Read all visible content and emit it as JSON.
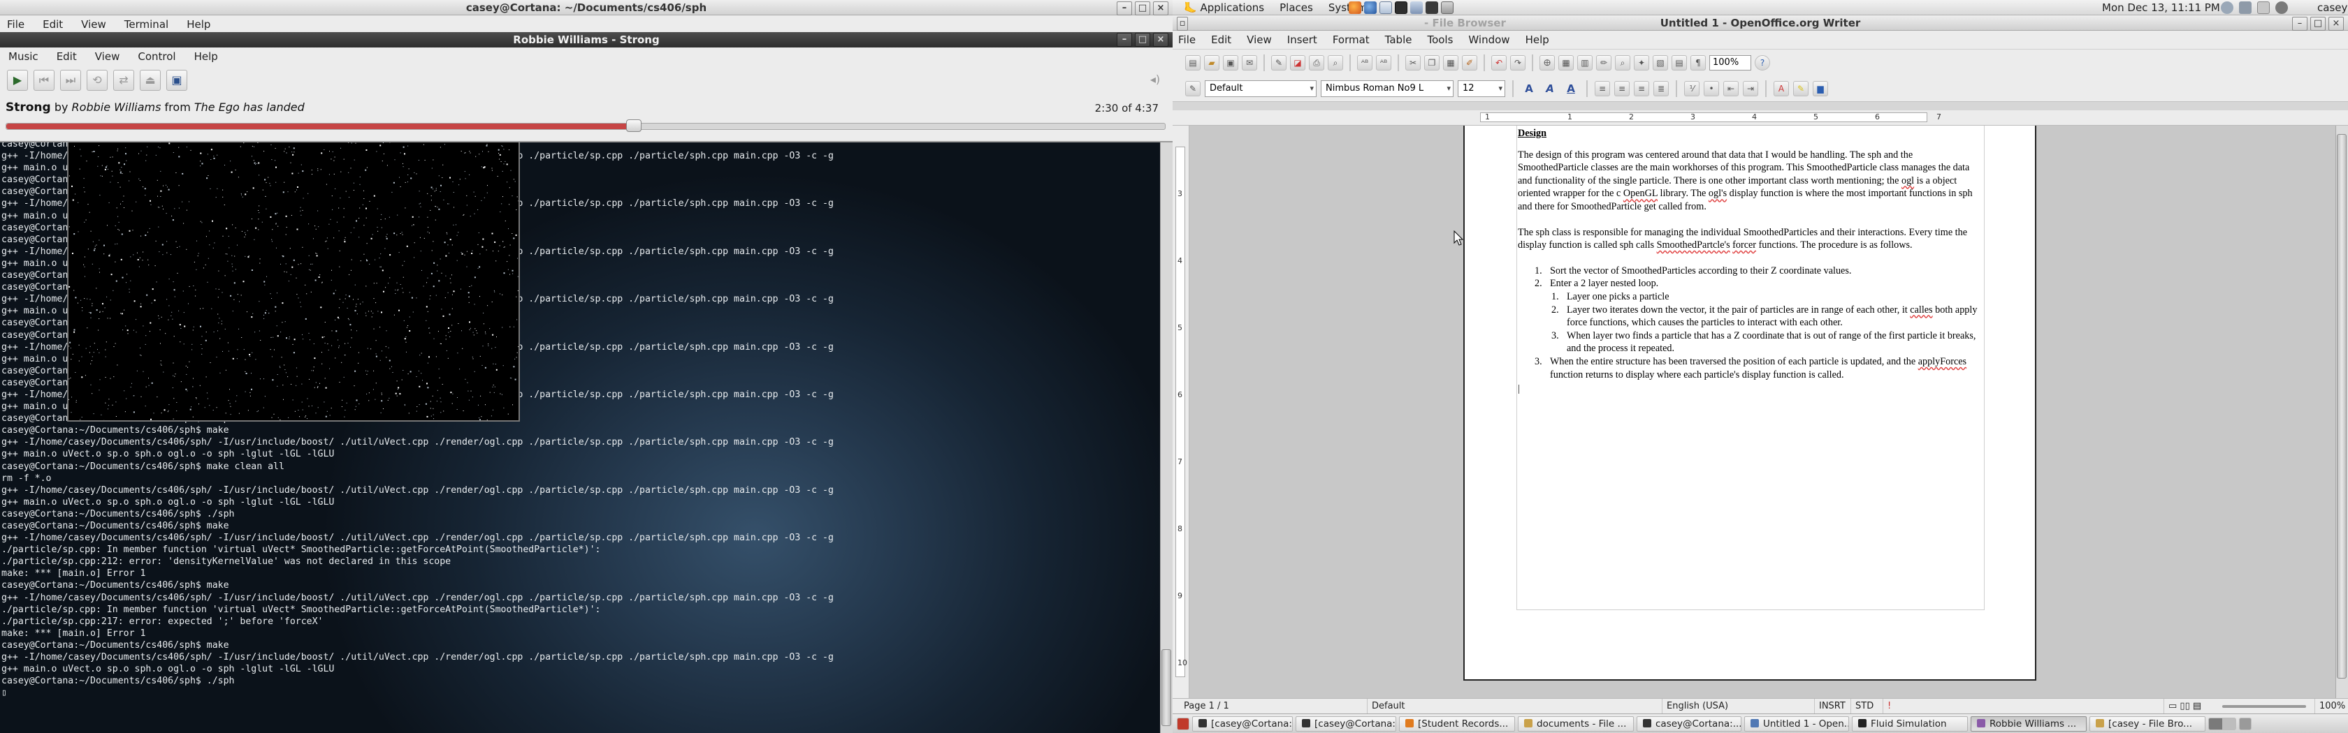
{
  "terminal": {
    "title": "casey@Cortana: ~/Documents/cs406/sph",
    "menu": [
      "File",
      "Edit",
      "View",
      "Terminal",
      "Help"
    ],
    "lines": [
      "casey@Cortana:~/Documents/cs406/sph$ make",
      "g++ -I/home/casey/Documents/cs406/sph/ -I/usr/include/boost/ ./util/uVect.cpp ./render/ogl.cpp ./particle/sp.cpp ./particle/sph.cpp main.cpp -O3 -c -g",
      "g++ main.o uVect.o sp.o sph.o ogl.o -o sph -lglut -lGL -lGLU",
      "casey@Cortana:~/Documents/cs406/sph$ ./sph",
      "casey@Cortana:~/Documents/cs406/sph$ make",
      "g++ -I/home/casey/Documents/cs406/sph/ -I/usr/include/boost/ ./util/uVect.cpp ./render/ogl.cpp ./particle/sp.cpp ./particle/sph.cpp main.cpp -O3 -c -g",
      "g++ main.o uVect.o sp.o sph.o ogl.o -o sph -lglut -lGL -lGLU",
      "casey@Cortana:~/Documents/cs406/sph$ ./sph",
      "casey@Cortana:~/Documents/cs406/sph$ make",
      "g++ -I/home/casey/Documents/cs406/sph/ -I/usr/include/boost/ ./util/uVect.cpp ./render/ogl.cpp ./particle/sp.cpp ./particle/sph.cpp main.cpp -O3 -c -g",
      "g++ main.o uVect.o sp.o sph.o ogl.o -o sph -lglut -lGL -lGLU",
      "casey@Cortana:~/Documents/cs406/sph$ ./sph",
      "casey@Cortana:~/Documents/cs406/sph$ make",
      "g++ -I/home/casey/Documents/cs406/sph/ -I/usr/include/boost/ ./util/uVect.cpp ./render/ogl.cpp ./particle/sp.cpp ./particle/sph.cpp main.cpp -O3 -c -g",
      "g++ main.o uVect.o sp.o sph.o ogl.o -o sph -lglut -lGL -lGLU",
      "casey@Cortana:~/Documents/cs406/sph$ ./sph",
      "casey@Cortana:~/Documents/cs406/sph$ make",
      "g++ -I/home/casey/Documents/cs406/sph/ -I/usr/include/boost/ ./util/uVect.cpp ./render/ogl.cpp ./particle/sp.cpp ./particle/sph.cpp main.cpp -O3 -c -g",
      "g++ main.o uVect.o sp.o sph.o ogl.o -o sph -lglut -lGL -lGLU",
      "casey@Cortana:~/Documents/cs406/sph$ ./sph",
      "casey@Cortana:~/Documents/cs406/sph$ make",
      "g++ -I/home/casey/Documents/cs406/sph/ -I/usr/include/boost/ ./util/uVect.cpp ./render/ogl.cpp ./particle/sp.cpp ./particle/sph.cpp main.cpp -O3 -c -g",
      "g++ main.o uVect.o sp.o sph.o ogl.o -o sph -lglut -lGL -lGLU",
      "casey@Cortana:~/Documents/cs406/sph$ ./sph",
      "casey@Cortana:~/Documents/cs406/sph$ make",
      "g++ -I/home/casey/Documents/cs406/sph/ -I/usr/include/boost/ ./util/uVect.cpp ./render/ogl.cpp ./particle/sp.cpp ./particle/sph.cpp main.cpp -O3 -c -g",
      "g++ main.o uVect.o sp.o sph.o ogl.o -o sph -lglut -lGL -lGLU",
      "casey@Cortana:~/Documents/cs406/sph$ make clean all",
      "rm -f *.o",
      "g++ -I/home/casey/Documents/cs406/sph/ -I/usr/include/boost/ ./util/uVect.cpp ./render/ogl.cpp ./particle/sp.cpp ./particle/sph.cpp main.cpp -O3 -c -g",
      "g++ main.o uVect.o sp.o sph.o ogl.o -o sph -lglut -lGL -lGLU",
      "casey@Cortana:~/Documents/cs406/sph$ ./sph",
      "casey@Cortana:~/Documents/cs406/sph$ make",
      "g++ -I/home/casey/Documents/cs406/sph/ -I/usr/include/boost/ ./util/uVect.cpp ./render/ogl.cpp ./particle/sp.cpp ./particle/sph.cpp main.cpp -O3 -c -g",
      "./particle/sp.cpp: In member function 'virtual uVect* SmoothedParticle::getForceAtPoint(SmoothedParticle*)':",
      "./particle/sp.cpp:212: error: 'densityKernelValue' was not declared in this scope",
      "make: *** [main.o] Error 1",
      "casey@Cortana:~/Documents/cs406/sph$ make",
      "g++ -I/home/casey/Documents/cs406/sph/ -I/usr/include/boost/ ./util/uVect.cpp ./render/ogl.cpp ./particle/sp.cpp ./particle/sph.cpp main.cpp -O3 -c -g",
      "./particle/sp.cpp: In member function 'virtual uVect* SmoothedParticle::getForceAtPoint(SmoothedParticle*)':",
      "./particle/sp.cpp:217: error: expected ';' before 'forceX'",
      "make: *** [main.o] Error 1",
      "casey@Cortana:~/Documents/cs406/sph$ make",
      "g++ -I/home/casey/Documents/cs406/sph/ -I/usr/include/boost/ ./util/uVect.cpp ./render/ogl.cpp ./particle/sp.cpp ./particle/sph.cpp main.cpp -O3 -c -g",
      "g++ main.o uVect.o sp.o sph.o ogl.o -o sph -lglut -lGL -lGLU",
      "casey@Cortana:~/Documents/cs406/sph$ ./sph",
      "▯"
    ]
  },
  "music": {
    "title": "Robbie Williams - Strong",
    "menu": [
      "Music",
      "Edit",
      "View",
      "Control",
      "Help"
    ],
    "song": "Strong",
    "by": "by",
    "artist": "Robbie Williams",
    "from": "from",
    "album": "The Ego has landed",
    "time": "2:30 of 4:37",
    "progress": 0.541
  },
  "panel": {
    "menus": [
      "Applications",
      "Places",
      "System"
    ],
    "clock": "Mon Dec 13, 11:11 PM",
    "user": "casey"
  },
  "writer": {
    "title": "Untitled 1 - OpenOffice.org Writer",
    "ghost_title": "- File Browser",
    "menu": [
      "File",
      "Edit",
      "View",
      "Insert",
      "Format",
      "Table",
      "Tools",
      "Window",
      "Help"
    ],
    "zoom": "100%",
    "style": "Default",
    "font": "Nimbus Roman No9 L",
    "size": "12",
    "ruler_h": [
      "1",
      "1",
      "2",
      "3",
      "4",
      "5",
      "6",
      "7"
    ],
    "ruler_v": [
      "3",
      "4",
      "5",
      "6",
      "7",
      "8",
      "9",
      "10"
    ],
    "doc": {
      "heading": "Design",
      "p1": [
        "The design of this program was centered around that data that I would be handling.  The sph and the SmoothedParticle classes are the main workhorses of this program.  This SmoothedParticle class manages the data and functionality of the single particle.  There is one other important class worth mentioning; the ",
        "ogl",
        " is a object oriented wrapper for the c ",
        "OpenGL",
        " library.  The ",
        "ogl's",
        " display function is where the most important functions in sph and there for SmoothedParticle get called from."
      ],
      "p2": [
        "The sph class is responsible for managing the individual SmoothedParticles and their interactions.  Every time the display function is called sph calls ",
        "SmoothedPartcle's",
        " ",
        "forcer",
        " functions.  The procedure is as follows."
      ],
      "items": [
        {
          "n": "1.",
          "t": "Sort the vector of SmoothedParticles according to their Z coordinate values."
        },
        {
          "n": "2.",
          "t": "Enter a 2 layer nested loop."
        }
      ],
      "subitems": [
        {
          "n": "1.",
          "t": "Layer one picks a particle"
        },
        {
          "n": "2.",
          "a": "Layer two iterates down the vector, it the pair of particles are in range of each other, it ",
          "u": "calles",
          "b": " both apply force functions, which causes the particles to interact with each other."
        },
        {
          "n": "3.",
          "t": "When layer two finds a particle that has a Z coordinate that is out of range of the first particle it breaks, and the process it repeated."
        }
      ],
      "item3": {
        "n": "3.",
        "a": "When the entire structure has been traversed the position of each particle is updated, and the ",
        "u": "applyForces",
        "b": " function returns to display where each particle's display function is called."
      },
      "cursor": "|"
    },
    "status": {
      "page": "Page 1 / 1",
      "style": "Default",
      "lang": "English (USA)",
      "insrt": "INSRT",
      "std": "STD",
      "zoom": "100%"
    }
  },
  "taskbar": [
    {
      "label": "[casey@Cortana:...",
      "active": false
    },
    {
      "label": "[casey@Cortana:...",
      "active": false
    },
    {
      "label": "[Student Records...",
      "active": false
    },
    {
      "label": "documents - File ...",
      "active": false
    },
    {
      "label": "casey@Cortana:...",
      "active": false
    },
    {
      "label": "Untitled 1 - Open...",
      "active": false
    },
    {
      "label": "Fluid Simulation",
      "active": false
    },
    {
      "label": "Robbie Williams ...",
      "active": true
    },
    {
      "label": "[casey - File Bro...",
      "active": false
    }
  ],
  "colors": {
    "accent_progress": "#c64545",
    "terminal_text": "#e8ecef",
    "spell_error": "#e04040"
  }
}
